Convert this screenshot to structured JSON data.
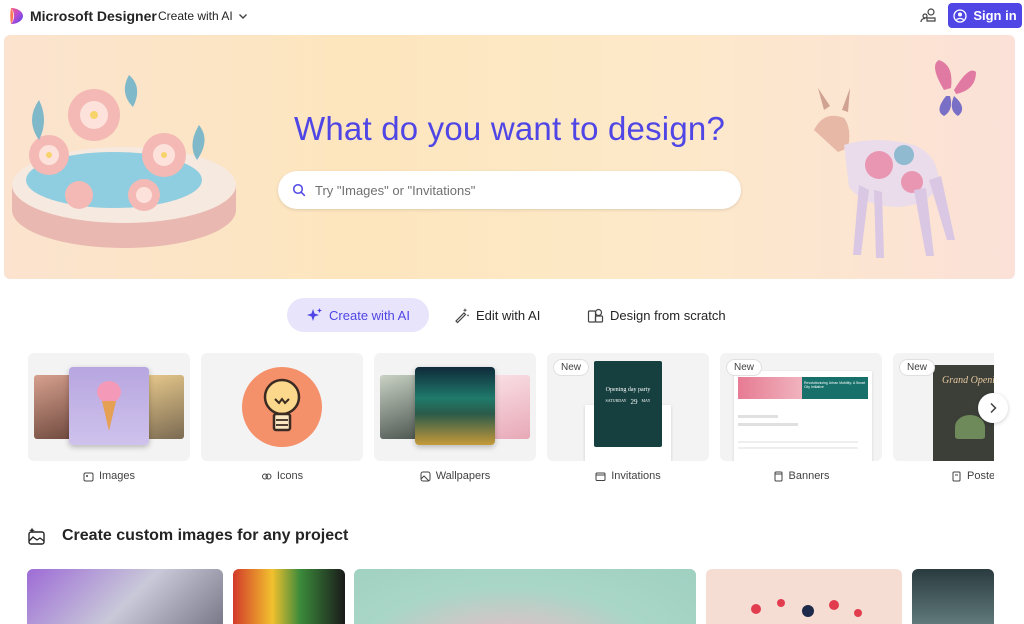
{
  "header": {
    "brand": "Microsoft Designer",
    "create_menu_label": "Create with AI",
    "signin_label": "Sign in",
    "accent_color": "#4f46e5"
  },
  "hero": {
    "title": "What do you want to design?",
    "search_placeholder": "Try \"Images\" or \"Invitations\""
  },
  "modes": [
    {
      "label": "Create with AI",
      "icon": "sparkle-icon",
      "active": true
    },
    {
      "label": "Edit with AI",
      "icon": "magic-wand-icon",
      "active": false
    },
    {
      "label": "Design from scratch",
      "icon": "shapes-icon",
      "active": false
    }
  ],
  "categories": [
    {
      "label": "Images",
      "icon": "image-sparkle-icon",
      "badge": ""
    },
    {
      "label": "Icons",
      "icon": "icons-icon",
      "badge": ""
    },
    {
      "label": "Wallpapers",
      "icon": "wallpaper-icon",
      "badge": ""
    },
    {
      "label": "Invitations",
      "icon": "invitation-icon",
      "badge": "New",
      "card_text": {
        "title": "Opening day party",
        "day": "SATURDAY",
        "date": "29",
        "month": "MAY"
      }
    },
    {
      "label": "Banners",
      "icon": "banner-icon",
      "badge": "New",
      "card_text": {
        "title": "Revolutionizing Urban Mobility: A Smart City Initiative"
      }
    },
    {
      "label": "Poster",
      "icon": "poster-icon",
      "badge": "New",
      "card_text": {
        "title": "Grand Openi"
      }
    }
  ],
  "section": {
    "title": "Create custom images for any project"
  }
}
